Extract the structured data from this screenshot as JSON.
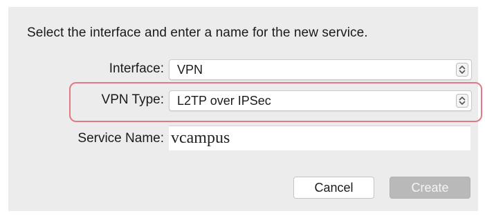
{
  "dialog": {
    "instruction": "Select the interface and enter a name for the new service."
  },
  "interface": {
    "label": "Interface:",
    "value": "VPN",
    "icon": "updown-stepper-icon"
  },
  "vpn_type": {
    "label": "VPN Type:",
    "value": "L2TP over IPSec",
    "icon": "updown-stepper-icon",
    "highlight_color": "#e07a82"
  },
  "service_name": {
    "label": "Service Name:",
    "value": "vcampus"
  },
  "buttons": {
    "cancel": "Cancel",
    "create": "Create"
  }
}
